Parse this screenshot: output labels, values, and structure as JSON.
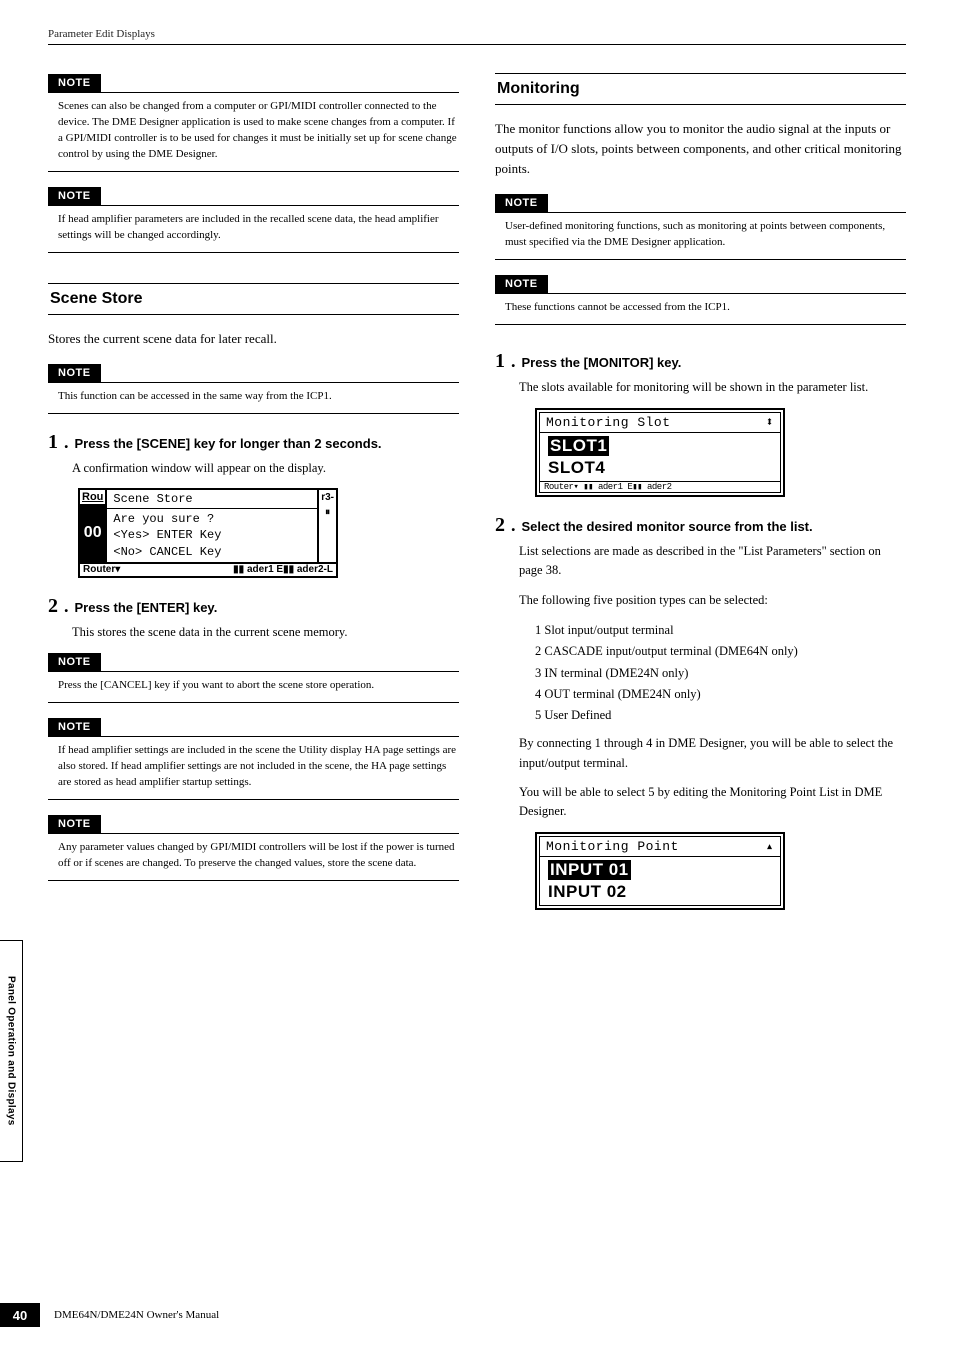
{
  "running_head": "Parameter Edit Displays",
  "left": {
    "notes": [
      "Scenes can also be changed from a computer or GPI/MIDI controller connected to the device.\nThe DME Designer application is used to make scene changes from a computer. If a GPI/MIDI controller is to be used for changes it must be initially set up for scene change control by using the DME Designer.",
      "If head amplifier parameters are included in the recalled scene data, the head amplifier settings will be changed accordingly."
    ],
    "scene_store": {
      "title": "Scene Store",
      "intro": "Stores the current scene data for later recall.",
      "note_icp": "This function can be accessed in the same way from the ICP1.",
      "steps": [
        {
          "num": "1",
          "head": "Press the [SCENE] key for longer than 2 seconds.",
          "desc": "A confirmation window will appear on the display."
        },
        {
          "num": "2",
          "head": "Press the [ENTER] key.",
          "desc": "This stores the scene data in the current scene memory."
        }
      ],
      "lcd": {
        "left_top": "Rou",
        "left_mid": "00",
        "title": "Scene Store",
        "line1": "Are you sure ?",
        "line2": "<Yes> ENTER Key",
        "line3": "<No>  CANCEL Key",
        "right_top": "r3-",
        "right_mid": "⏸",
        "footer_l": "Router▾",
        "footer_m": "▮▮ ader1  E▮▮ ader2-L"
      },
      "notes_after": [
        "Press the [CANCEL] key if you want to abort the scene store operation.",
        "If head amplifier settings are included in the scene the Utility display HA page settings are also stored. If head amplifier settings are not included in the scene, the HA page settings are stored as head amplifier startup settings.",
        "Any parameter values changed by GPI/MIDI controllers will be lost if the power is turned off or if scenes are changed. To preserve the changed values, store the scene data."
      ]
    }
  },
  "right": {
    "monitoring": {
      "title": "Monitoring",
      "intro": "The monitor functions allow you to monitor the audio signal at the inputs or outputs of I/O slots, points between components, and other critical monitoring points.",
      "notes": [
        "User-defined monitoring functions, such as monitoring at points between components, must specified via the DME Designer application.",
        "These functions cannot be accessed from the ICP1."
      ],
      "steps": [
        {
          "num": "1",
          "head": "Press the [MONITOR] key.",
          "desc": "The slots available for monitoring will be shown in the parameter list."
        },
        {
          "num": "2",
          "head": "Select the desired monitor source from the list.",
          "desc": "List selections are made as described in the \"List Parameters\" section on page 38.",
          "desc2": "The following five position types can be selected:",
          "list": [
            "1 Slot input/output terminal",
            "2 CASCADE input/output terminal (DME64N only)",
            "3 IN terminal (DME24N only)",
            "4 OUT terminal (DME24N only)",
            "5 User Defined"
          ],
          "after1": "By connecting 1 through 4 in DME Designer, you will be able to select the input/output terminal.",
          "after2": "You will be able to select 5 by editing the Monitoring Point List in DME Designer."
        }
      ],
      "lcd1": {
        "title": "Monitoring Slot",
        "row1": "SLOT1",
        "row2": "SLOT4",
        "footer": "Router▾  ▮▮ ader1  E▮▮ ader2"
      },
      "lcd2": {
        "title": "Monitoring Point",
        "row1": "INPUT 01",
        "row2": "INPUT 02"
      }
    }
  },
  "note_label": "NOTE",
  "side_tab": "Panel Operation and Displays",
  "page_num": "40",
  "foot_text": "DME64N/DME24N Owner's Manual"
}
